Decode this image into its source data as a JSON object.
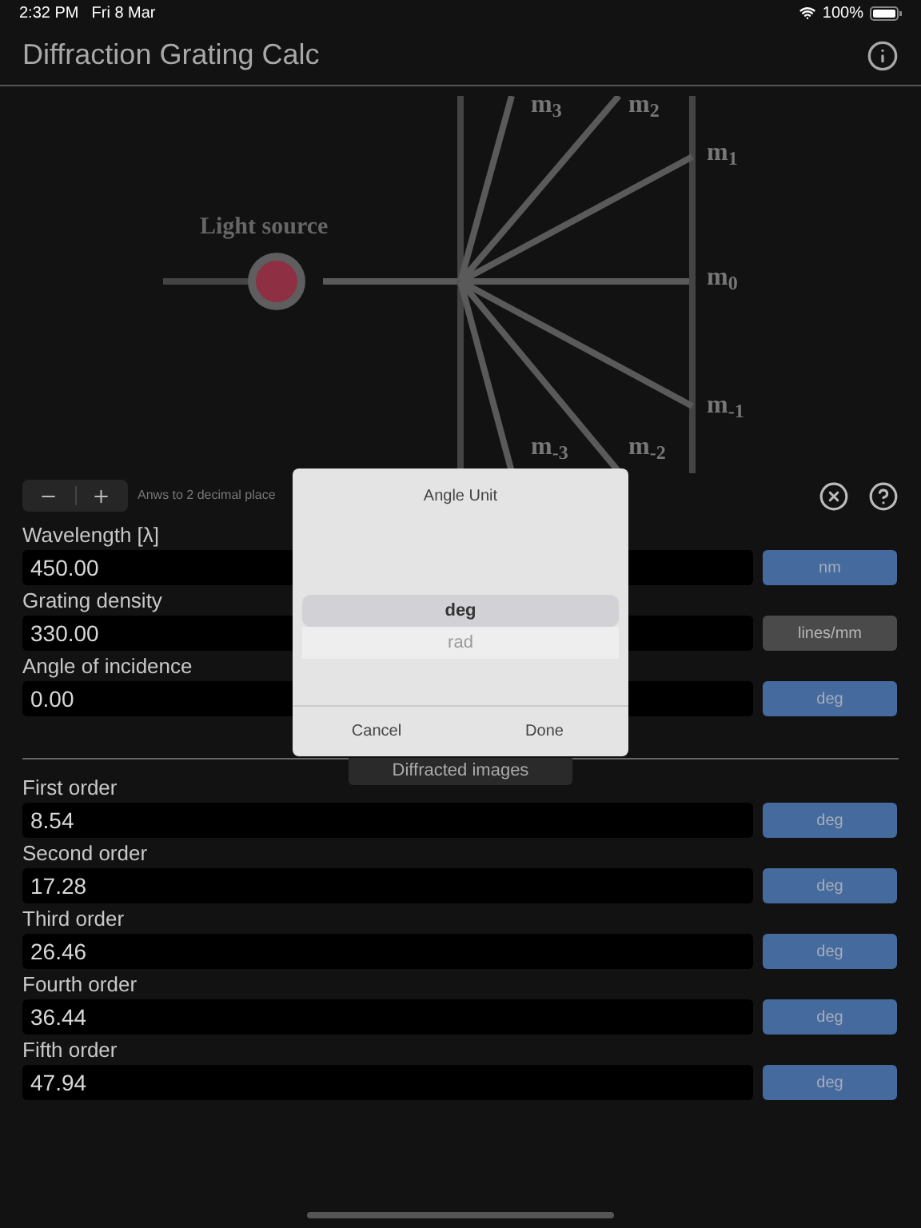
{
  "status_bar": {
    "time": "2:32 PM",
    "date": "Fri 8 Mar",
    "battery": "100%"
  },
  "title": "Diffraction Grating Calc",
  "diagram": {
    "source_label": "Light source",
    "order_labels": [
      "m$_{3}$",
      "m$_{2}$",
      "m$_{1}$",
      "m$_{0}$",
      "m$_{-1}$",
      "m$_{-3}$",
      "m$_{-2}$"
    ]
  },
  "precision": {
    "label": "Anws to 2 decimal place"
  },
  "inputs": [
    {
      "label": "Wavelength [λ]",
      "value": "450.00",
      "unit": "nm",
      "disabled": false
    },
    {
      "label": "Grating density",
      "value": "330.00",
      "unit": "lines/mm",
      "disabled": true
    },
    {
      "label": "Angle of incidence",
      "value": "0.00",
      "unit": "deg",
      "disabled": false
    }
  ],
  "section_title": "Diffracted images",
  "results": [
    {
      "label": "First order",
      "value": "8.54",
      "unit": "deg",
      "disabled": false
    },
    {
      "label": "Second order",
      "value": "17.28",
      "unit": "deg",
      "disabled": false
    },
    {
      "label": "Third order",
      "value": "26.46",
      "unit": "deg",
      "disabled": false
    },
    {
      "label": "Fourth order",
      "value": "36.44",
      "unit": "deg",
      "disabled": false
    },
    {
      "label": "Fifth order",
      "value": "47.94",
      "unit": "deg",
      "disabled": false
    }
  ],
  "dialog": {
    "title": "Angle Unit",
    "options": [
      {
        "label": "deg",
        "selected": true
      },
      {
        "label": "rad",
        "selected": false
      }
    ],
    "buttons": [
      "Cancel",
      "Done"
    ]
  }
}
